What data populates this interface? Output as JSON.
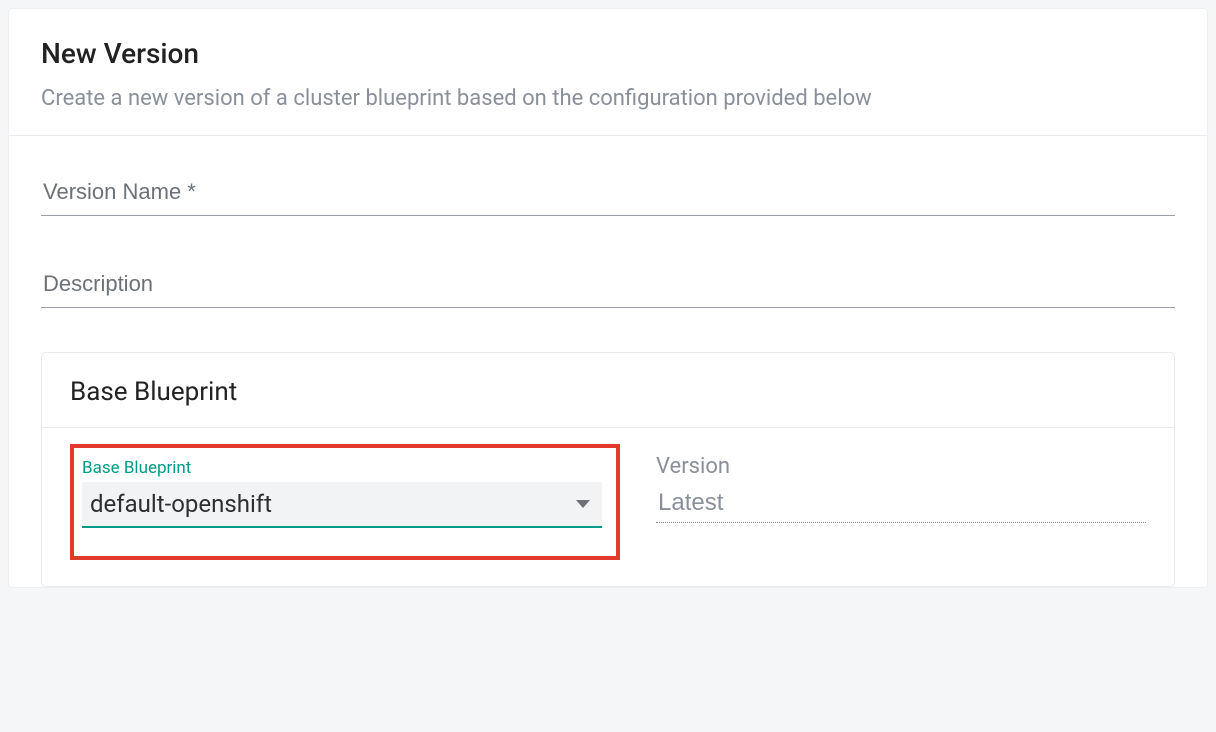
{
  "header": {
    "title": "New Version",
    "subtitle": "Create a new version of a cluster blueprint based on the configuration provided below"
  },
  "fields": {
    "version_name": {
      "placeholder": "Version Name *",
      "value": ""
    },
    "description": {
      "placeholder": "Description",
      "value": ""
    }
  },
  "base_blueprint": {
    "section_title": "Base Blueprint",
    "select_label": "Base Blueprint",
    "select_value": "default-openshift",
    "version_label": "Version",
    "version_value": "Latest"
  }
}
